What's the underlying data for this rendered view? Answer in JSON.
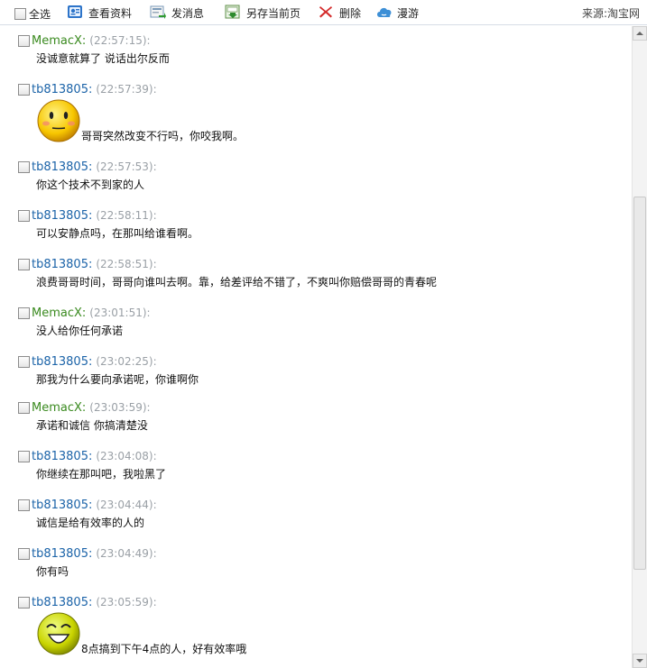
{
  "toolbar": {
    "select_all": "全选",
    "view_profile": "查看资料",
    "send_message": "发消息",
    "save_page": "另存当前页",
    "delete": "删除",
    "roaming": "漫游",
    "source": "来源:淘宝网"
  },
  "messages": [
    {
      "sender": "MemacX:",
      "time": "(22:57:15):",
      "text": "没诚意就算了 说话出尔反而",
      "self": true
    },
    {
      "sender": "tb813805:",
      "time": "(22:57:39):",
      "text": "哥哥突然改变不行吗，你咬我啊。",
      "self": false,
      "emoji": "smiley-emoji"
    },
    {
      "sender": "tb813805:",
      "time": "(22:57:53):",
      "text": "你这个技术不到家的人",
      "self": false
    },
    {
      "sender": "tb813805:",
      "time": "(22:58:11):",
      "text": "可以安静点吗，在那叫给谁看啊。",
      "self": false
    },
    {
      "sender": "tb813805:",
      "time": "(22:58:51):",
      "text": "浪费哥哥时间，哥哥向谁叫去啊。靠，给差评给不错了，不爽叫你赔偿哥哥的青春呢",
      "self": false
    },
    {
      "sender": "MemacX:",
      "time": "(23:01:51):",
      "text": "没人给你任何承诺",
      "self": true
    },
    {
      "sender": "tb813805:",
      "time": "(23:02:25):",
      "text": "那我为什么要向承诺呢，你谁啊你",
      "self": false
    },
    {
      "sender": "MemacX:",
      "time": "(23:03:59):",
      "text": "承诺和诚信 你搞清楚没",
      "self": true
    },
    {
      "sender": "tb813805:",
      "time": "(23:04:08):",
      "text": "你继续在那叫吧，我啦黑了",
      "self": false
    },
    {
      "sender": "tb813805:",
      "time": "(23:04:44):",
      "text": "诚信是给有效率的人的",
      "self": false
    },
    {
      "sender": "tb813805:",
      "time": "(23:04:49):",
      "text": "你有吗",
      "self": false
    },
    {
      "sender": "tb813805:",
      "time": "(23:05:59):",
      "text": "8点搞到下午4点的人，好有效率哦",
      "self": false,
      "emoji": "laughing-emoji"
    }
  ],
  "colors": {
    "self_sender": "#3a8a1f",
    "other_sender": "#1b63a8",
    "timestamp": "#9aa0a6"
  }
}
